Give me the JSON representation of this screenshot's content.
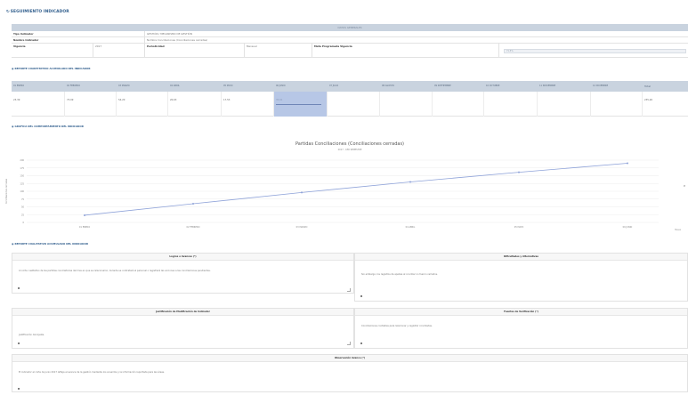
{
  "page": {
    "title": "SEGUIMIENTO INDICADOR"
  },
  "general": {
    "header": "DATOS GENERALES",
    "tipo_label": "Tipo Indicador",
    "tipo_value": "GESTIÓN / MECANISMO DE GESTIÓN",
    "nombre_label": "Nombre Indicador",
    "nombre_value": "Nombre Conciliaciones (Conciliaciones cerradas)",
    "vigencia_label": "Vigencia",
    "vigencia_value": "2017",
    "periodicidad_label": "Periodicidad",
    "periodicidad_value": "Mensual",
    "meta_label": "Meta Programada Vigencia",
    "meta_placeholder": "71,5%"
  },
  "monthly": {
    "section_title": "REPORTE CUANTITATIVO ACUMULADO DEL INDICADOR",
    "headers": [
      "01 ENERO",
      "02 FEBRERO",
      "03 MARZO",
      "04 ABRIL",
      "05 MAYO",
      "06 JUNIO",
      "07 JULIO",
      "08 AGOSTO",
      "09 SEPTIEMBRE",
      "10 OCTUBRE",
      "11 NOVIEMBRE",
      "12 DICIEMBRE",
      "Total"
    ],
    "values": [
      "23,39",
      "73,09",
      "54,20",
      "20,63",
      "17,53",
      "35,61",
      "",
      "",
      "",
      "",
      "",
      "",
      "235,26"
    ]
  },
  "chart_section": {
    "title": "GRÁFICA DEL COMPORTAMIENTO DEL INDICADOR"
  },
  "chart_data": {
    "type": "line",
    "title": "Partidas Conciliaciones (Conciliaciones cerradas)",
    "subtitle": "2017 - 1ER SEMESTRE",
    "ylabel": "Conciliaciones cerradas",
    "categories": [
      "01 ENERO",
      "02 FEBRERO",
      "03 MARZO",
      "04 ABRIL",
      "05 MAYO",
      "06 JUNIO"
    ],
    "values": [
      23,
      60,
      96,
      130,
      161,
      190
    ],
    "y_ticks": [
      "0",
      "25",
      "50",
      "75",
      "100",
      "125",
      "150",
      "175",
      "200"
    ],
    "ylim": [
      0,
      200
    ],
    "grid": true,
    "legend": "right",
    "legend_label": "M",
    "x_axis_end_label": "Meses",
    "line_color": "#8fa3d9"
  },
  "qualitative": {
    "section_title": "REPORTE CUALITATIVO ACUMULADO DEL INDICADOR",
    "logros_header": "Logros o Avances (*)",
    "logros_text": "Al corte cualitativo de las partidas conciliatorias del mes en que se relacionaron, durante se contratará el personal o registrará las acciones a las conciliaciones pendientes.",
    "logros_badge": "B",
    "dificultades_header": "Dificultades y Alternativas",
    "dificultades_text": "Sin embargo, los registros de ajustes al conciliar no fueron cerrados.",
    "dificultades_badge": "B",
    "justificacion_header": "Justificación de Modificación de Indicador",
    "justificacion_text": "Justificación del Ajuste.",
    "justificacion_badge": "B",
    "fuentes_header": "Fuentes de Verificación (*)",
    "fuentes_text": "Conciliaciones contables para relacionar y registrar conciliadas.",
    "fuentes_badge": "B",
    "observacion_header": "Observación Avance (*)",
    "observacion_text": "El indicador al corte de junio 2017 refleja el avance de la gestión mediante los acuerdos y la información reportada para las áreas.",
    "observacion_badge": "B"
  }
}
